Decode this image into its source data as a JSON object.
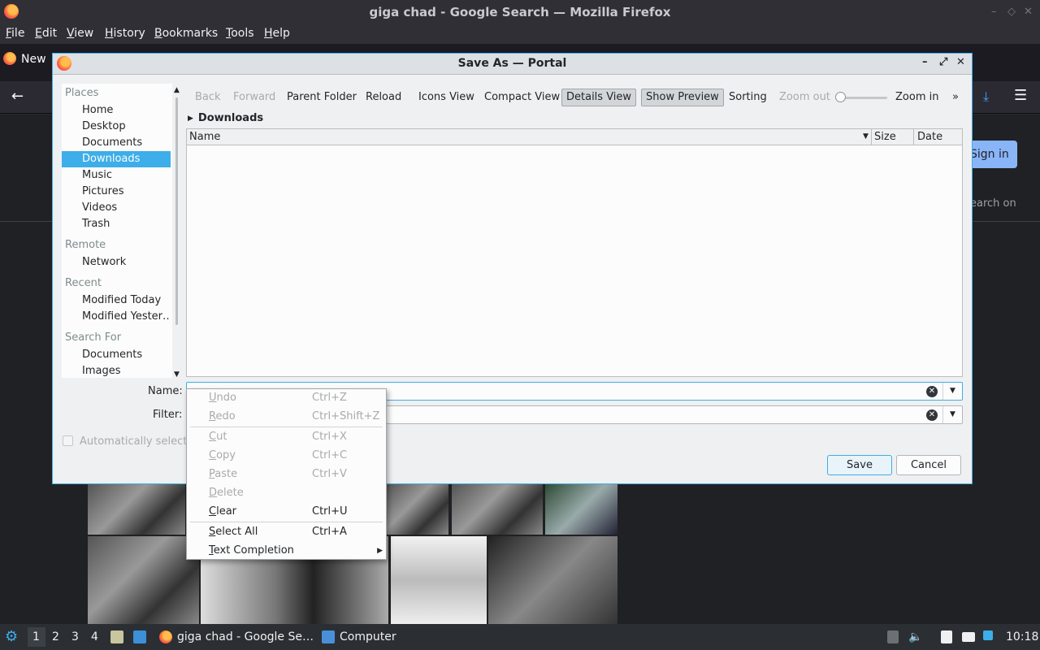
{
  "browser": {
    "window_title": "giga chad - Google Search — Mozilla Firefox",
    "menu": [
      "File",
      "Edit",
      "View",
      "History",
      "Bookmarks",
      "Tools",
      "Help"
    ],
    "tab_label": "New",
    "page": {
      "signin": "Sign in",
      "search_on": "earch on"
    }
  },
  "dialog": {
    "title": "Save As — Portal",
    "places": {
      "sections": [
        {
          "title": "Places",
          "items": [
            "Home",
            "Desktop",
            "Documents",
            "Downloads",
            "Music",
            "Pictures",
            "Videos",
            "Trash"
          ]
        },
        {
          "title": "Remote",
          "items": [
            "Network"
          ]
        },
        {
          "title": "Recent",
          "items": [
            "Modified Today",
            "Modified Yester…"
          ]
        },
        {
          "title": "Search For",
          "items": [
            "Documents",
            "Images"
          ]
        }
      ],
      "selected": "Downloads"
    },
    "toolbar": {
      "back": "Back",
      "forward": "Forward",
      "parent": "Parent Folder",
      "reload": "Reload",
      "icons_view": "Icons View",
      "compact_view": "Compact View",
      "details_view": "Details View",
      "show_preview": "Show Preview",
      "sorting": "Sorting",
      "zoom_out": "Zoom out",
      "zoom_in": "Zoom in",
      "more": "»"
    },
    "breadcrumb": "Downloads",
    "columns": [
      "Name",
      "Size",
      "Date"
    ],
    "name_label": "Name:",
    "name_value": "",
    "filter_label": "Filter:",
    "filter_value": "",
    "auto_select": "Automatically select fi",
    "save": "Save",
    "cancel": "Cancel"
  },
  "context_menu": [
    {
      "label": "Undo",
      "shortcut": "Ctrl+Z",
      "enabled": false
    },
    {
      "label": "Redo",
      "shortcut": "Ctrl+Shift+Z",
      "enabled": false
    },
    {
      "label": "Cut",
      "shortcut": "Ctrl+X",
      "enabled": false
    },
    {
      "label": "Copy",
      "shortcut": "Ctrl+C",
      "enabled": false
    },
    {
      "label": "Paste",
      "shortcut": "Ctrl+V",
      "enabled": false
    },
    {
      "label": "Delete",
      "shortcut": "",
      "enabled": false
    },
    {
      "label": "Clear",
      "shortcut": "Ctrl+U",
      "enabled": true
    },
    {
      "label": "Select All",
      "shortcut": "Ctrl+A",
      "enabled": true
    },
    {
      "label": "Text Completion",
      "shortcut": "",
      "enabled": true,
      "submenu": true
    }
  ],
  "taskbar": {
    "workspaces": [
      "1",
      "2",
      "3",
      "4"
    ],
    "window_firefox": "giga chad - Google Se…",
    "window_files": "Computer",
    "clock": "10:18"
  }
}
